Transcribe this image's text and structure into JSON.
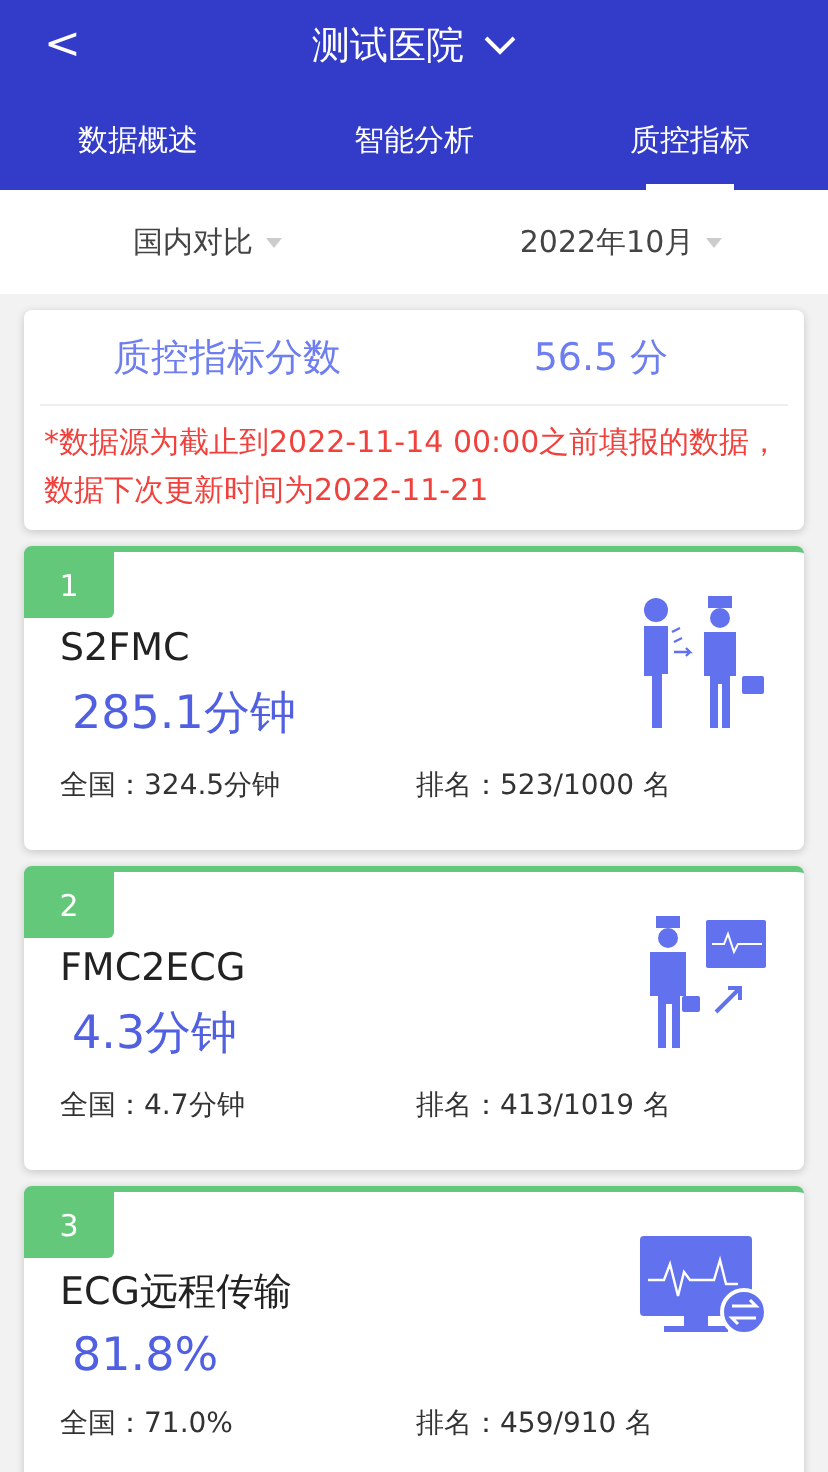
{
  "header": {
    "back": "<",
    "title": "测试医院"
  },
  "tabs": [
    {
      "label": "数据概述",
      "selected": false
    },
    {
      "label": "智能分析",
      "selected": false
    },
    {
      "label": "质控指标",
      "selected": true
    }
  ],
  "filters": [
    {
      "label": "国内对比"
    },
    {
      "label": "2022年10月"
    }
  ],
  "summary": {
    "label": "质控指标分数",
    "score": "56.5 分",
    "note": "*数据源为截止到2022-11-14 00:00之前填报的数据，数据下次更新时间为2022-11-21"
  },
  "metrics": [
    {
      "index": "1",
      "name": "S2FMC",
      "value": "285.1分钟",
      "national": "全国：324.5分钟",
      "rank": "排名：523/1000 名",
      "kind": "patient-doctor"
    },
    {
      "index": "2",
      "name": "FMC2ECG",
      "value": "4.3分钟",
      "national": "全国：4.7分钟",
      "rank": "排名：413/1019 名",
      "kind": "doctor-monitor"
    },
    {
      "index": "3",
      "name": "ECG远程传输",
      "value": "81.8%",
      "national": "全国：71.0%",
      "rank": "排名：459/910 名",
      "kind": "monitor-transfer"
    }
  ]
}
